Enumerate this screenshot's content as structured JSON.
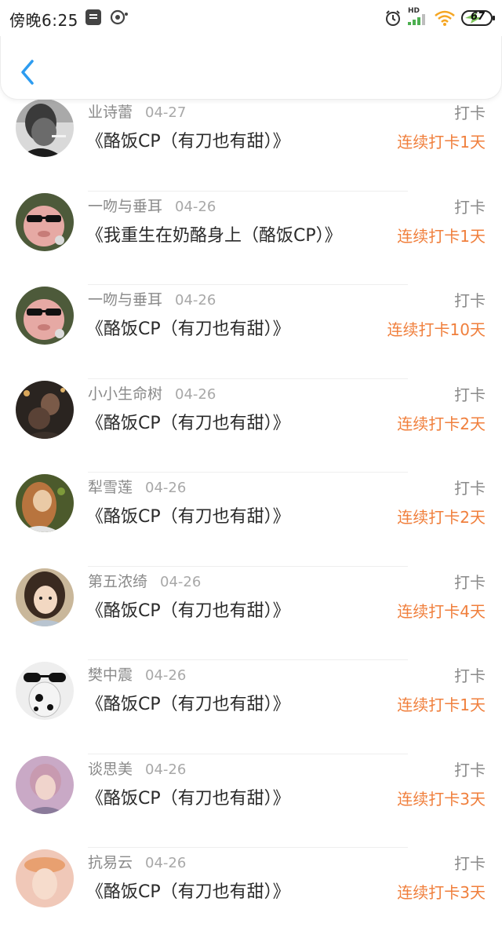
{
  "status_bar": {
    "time": "傍晚6:25",
    "hd_label": "HD",
    "battery": "67"
  },
  "header": {
    "back_icon": "chevron-left-icon"
  },
  "action_label": "打卡",
  "entries": [
    {
      "user": "业诗蕾",
      "date": "04-27",
      "title": "《酪饭CP（有刀也有甜）》",
      "streak": "连续打卡1天"
    },
    {
      "user": "一吻与垂耳",
      "date": "04-26",
      "title": "《我重生在奶酪身上（酪饭CP）》",
      "streak": "连续打卡1天"
    },
    {
      "user": "一吻与垂耳",
      "date": "04-26",
      "title": "《酪饭CP（有刀也有甜）》",
      "streak": "连续打卡10天"
    },
    {
      "user": "小小生命树",
      "date": "04-26",
      "title": "《酪饭CP（有刀也有甜）》",
      "streak": "连续打卡2天"
    },
    {
      "user": "犁雪莲",
      "date": "04-26",
      "title": "《酪饭CP（有刀也有甜）》",
      "streak": "连续打卡2天"
    },
    {
      "user": "第五浓绮",
      "date": "04-26",
      "title": "《酪饭CP（有刀也有甜）》",
      "streak": "连续打卡4天"
    },
    {
      "user": "樊中震",
      "date": "04-26",
      "title": "《酪饭CP（有刀也有甜）》",
      "streak": "连续打卡1天"
    },
    {
      "user": "谈思美",
      "date": "04-26",
      "title": "《酪饭CP（有刀也有甜）》",
      "streak": "连续打卡3天"
    },
    {
      "user": "抗易云",
      "date": "04-26",
      "title": "《酪饭CP（有刀也有甜）》",
      "streak": "连续打卡3天"
    }
  ],
  "colors": {
    "accent_orange": "#f07f3c",
    "back_blue": "#2d9cf0",
    "muted_text": "#8a8a8a",
    "title_text": "#2a2a2a"
  }
}
